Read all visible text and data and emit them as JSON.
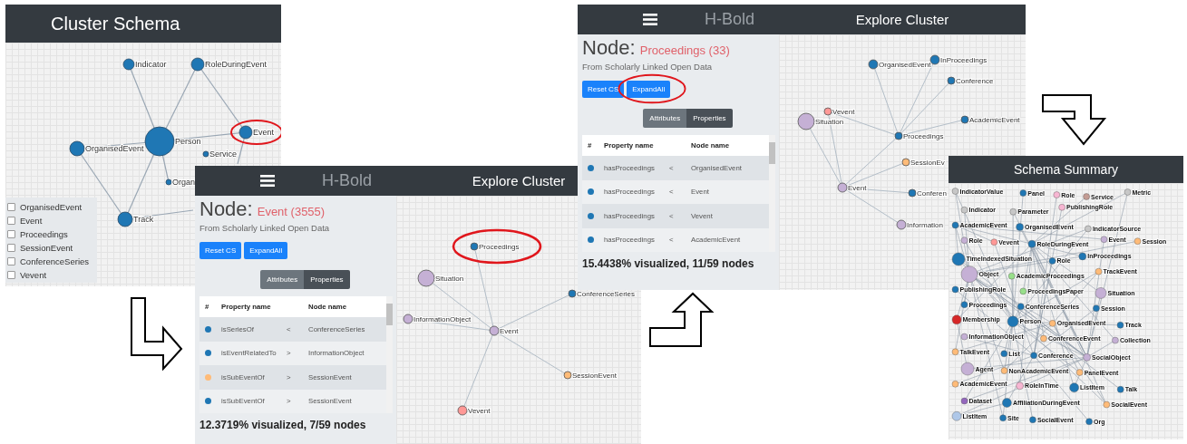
{
  "cluster_schema": {
    "title": "Cluster Schema",
    "nodes": [
      {
        "label": "Indicator",
        "color": "#1f77b4",
        "circled": false
      },
      {
        "label": "RoleDuringEvent",
        "color": "#1f77b4",
        "circled": false
      },
      {
        "label": "Person",
        "color": "#1f77b4",
        "circled": false
      },
      {
        "label": "OrganisedEvent",
        "color": "#1f77b4",
        "circled": false
      },
      {
        "label": "Event",
        "color": "#1f77b4",
        "circled": true
      },
      {
        "label": "Service",
        "color": "#1f77b4",
        "circled": false
      },
      {
        "label": "Organi",
        "color": "#1f77b4",
        "circled": false
      },
      {
        "label": "Track",
        "color": "#1f77b4",
        "circled": false
      }
    ],
    "legend": [
      {
        "label": "OrganisedEvent",
        "checked": false
      },
      {
        "label": "Event",
        "checked": false
      },
      {
        "label": "Proceedings",
        "checked": false
      },
      {
        "label": "SessionEvent",
        "checked": false
      },
      {
        "label": "ConferenceSeries",
        "checked": false
      },
      {
        "label": "Vevent",
        "checked": false
      }
    ]
  },
  "explore_panels": [
    {
      "brand": "H-Bold",
      "title": "Explore Cluster",
      "node_heading": "Node:",
      "node_name": "Event (3555)",
      "source": "From Scholarly Linked Open Data",
      "buttons": [
        {
          "label": "Reset CS",
          "circled": false
        },
        {
          "label": "ExpandAll",
          "circled": false
        }
      ],
      "toggle": [
        {
          "label": "Attributes",
          "selected": false
        },
        {
          "label": "Properties",
          "selected": true
        }
      ],
      "table": {
        "columns": [
          "#",
          "Property name",
          "Node name"
        ],
        "rows": [
          {
            "color": "#1f77b4",
            "property": "isSeriesOf",
            "direction": "<",
            "node": "ConferenceSeries"
          },
          {
            "color": "#1f77b4",
            "property": "isEventRelatedTo",
            "direction": ">",
            "node": "InformationObject"
          },
          {
            "color": "#ffbb78",
            "property": "isSubEventOf",
            "direction": ">",
            "node": "SessionEvent"
          },
          {
            "color": "#1f77b4",
            "property": "isSubEventOf",
            "direction": ">",
            "node": "SessionEvent"
          }
        ]
      },
      "status": "12.3719% visualized, 7/59 nodes",
      "graph": [
        {
          "label": "Proceedings",
          "color": "#1f77b4",
          "circled": true
        },
        {
          "label": "Situation",
          "color": "#c5b0d5",
          "circled": false
        },
        {
          "label": "ConferenceSeries",
          "color": "#1f77b4",
          "circled": false
        },
        {
          "label": "InformationObject",
          "color": "#c5b0d5",
          "circled": false
        },
        {
          "label": "Event",
          "color": "#c5b0d5",
          "circled": false
        },
        {
          "label": "SessionEvent",
          "color": "#ffbb78",
          "circled": false
        },
        {
          "label": "Vevent",
          "color": "#ff9896",
          "circled": false
        }
      ]
    },
    {
      "brand": "H-Bold",
      "title": "Explore Cluster",
      "node_heading": "Node:",
      "node_name": "Proceedings (33)",
      "source": "From Scholarly Linked Open Data",
      "buttons": [
        {
          "label": "Reset CS",
          "circled": false
        },
        {
          "label": "ExpandAll",
          "circled": true
        }
      ],
      "toggle": [
        {
          "label": "Attributes",
          "selected": false
        },
        {
          "label": "Properties",
          "selected": true
        }
      ],
      "table": {
        "columns": [
          "#",
          "Property name",
          "Node name"
        ],
        "rows": [
          {
            "color": "#1f77b4",
            "property": "hasProceedings",
            "direction": "<",
            "node": "OrganisedEvent"
          },
          {
            "color": "#1f77b4",
            "property": "hasProceedings",
            "direction": "<",
            "node": "Event"
          },
          {
            "color": "#1f77b4",
            "property": "hasProceedings",
            "direction": "<",
            "node": "Vevent"
          },
          {
            "color": "#1f77b4",
            "property": "hasProceedings",
            "direction": "<",
            "node": "AcademicEvent"
          }
        ]
      },
      "status": "15.4438% visualized, 11/59 nodes",
      "graph": [
        {
          "label": "OrganisedEvent",
          "color": "#1f77b4",
          "circled": false
        },
        {
          "label": "InProceedings",
          "color": "#1f77b4",
          "circled": false
        },
        {
          "label": "Conference",
          "color": "#1f77b4",
          "circled": false
        },
        {
          "label": "Vevent",
          "color": "#ff9896",
          "circled": false
        },
        {
          "label": "Situation",
          "color": "#c5b0d5",
          "circled": false
        },
        {
          "label": "AcademicEvent",
          "color": "#1f77b4",
          "circled": false
        },
        {
          "label": "Proceedings",
          "color": "#1f77b4",
          "circled": false
        },
        {
          "label": "SessionEv",
          "color": "#ffbb78",
          "circled": false
        },
        {
          "label": "Event",
          "color": "#c5b0d5",
          "circled": false
        },
        {
          "label": "Conferen",
          "color": "#1f77b4",
          "circled": false
        },
        {
          "label": "Information",
          "color": "#c5b0d5",
          "circled": false
        }
      ]
    }
  ],
  "schema_summary": {
    "title": "Schema Summary",
    "nodes": [
      {
        "label": "IndicatorValue",
        "color": "#c7c7c7"
      },
      {
        "label": "Panel",
        "color": "#1f77b4"
      },
      {
        "label": "Role",
        "color": "#f7b6d2"
      },
      {
        "label": "Service",
        "color": "#c49c94"
      },
      {
        "label": "Metric",
        "color": "#c7c7c7"
      },
      {
        "label": "Indicator",
        "color": "#c7c7c7"
      },
      {
        "label": "Parameter",
        "color": "#c7c7c7"
      },
      {
        "label": "PublishingRole",
        "color": "#f7b6d2"
      },
      {
        "label": "AcademicEvent",
        "color": "#1f77b4"
      },
      {
        "label": "OrganisedEvent",
        "color": "#1f77b4"
      },
      {
        "label": "IndicatorSource",
        "color": "#c7c7c7"
      },
      {
        "label": "Role",
        "color": "#c5b0d5"
      },
      {
        "label": "Vevent",
        "color": "#ff9896"
      },
      {
        "label": "RoleDuringEvent",
        "color": "#1f77b4"
      },
      {
        "label": "Event",
        "color": "#c5b0d5"
      },
      {
        "label": "Session",
        "color": "#ffbb78"
      },
      {
        "label": "TimeIndexedSituation",
        "color": "#1f77b4"
      },
      {
        "label": "Role",
        "color": "#1f77b4"
      },
      {
        "label": "InProceedings",
        "color": "#1f77b4"
      },
      {
        "label": "Object",
        "color": "#c5b0d5"
      },
      {
        "label": "AcademicProceedings",
        "color": "#98df8a"
      },
      {
        "label": "TrackEvent",
        "color": "#ffbb78"
      },
      {
        "label": "PublishingRole",
        "color": "#1f77b4"
      },
      {
        "label": "ProceedingsPaper",
        "color": "#98df8a"
      },
      {
        "label": "Situation",
        "color": "#c5b0d5"
      },
      {
        "label": "Proceedings",
        "color": "#1f77b4"
      },
      {
        "label": "ConferenceSeries",
        "color": "#1f77b4"
      },
      {
        "label": "Session",
        "color": "#1f77b4"
      },
      {
        "label": "Membership",
        "color": "#d62728"
      },
      {
        "label": "Person",
        "color": "#1f77b4"
      },
      {
        "label": "OrganisedEvent",
        "color": "#ffbb78"
      },
      {
        "label": "Track",
        "color": "#1f77b4"
      },
      {
        "label": "InformationObject",
        "color": "#c5b0d5"
      },
      {
        "label": "ConferenceEvent",
        "color": "#ffbb78"
      },
      {
        "label": "Collection",
        "color": "#c5b0d5"
      },
      {
        "label": "TalkEvent",
        "color": "#ffbb78"
      },
      {
        "label": "List",
        "color": "#1f77b4"
      },
      {
        "label": "Conference",
        "color": "#1f77b4"
      },
      {
        "label": "SocialObject",
        "color": "#c5b0d5"
      },
      {
        "label": "Agent",
        "color": "#c5b0d5"
      },
      {
        "label": "NonAcademicEvent",
        "color": "#ffbb78"
      },
      {
        "label": "PanelEvent",
        "color": "#ffbb78"
      },
      {
        "label": "AcademicEvent",
        "color": "#ffbb78"
      },
      {
        "label": "RoleInTime",
        "color": "#f7b6d2"
      },
      {
        "label": "ListItem",
        "color": "#1f77b4"
      },
      {
        "label": "Talk",
        "color": "#1f77b4"
      },
      {
        "label": "Dataset",
        "color": "#9467bd"
      },
      {
        "label": "AffiliationDuringEvent",
        "color": "#1f77b4"
      },
      {
        "label": "SocialEvent",
        "color": "#ffbb78"
      },
      {
        "label": "ListItem",
        "color": "#aec7e8"
      },
      {
        "label": "Site",
        "color": "#1f77b4"
      },
      {
        "label": "SocialEvent",
        "color": "#1f77b4"
      },
      {
        "label": "Org",
        "color": "#1f77b4"
      }
    ]
  }
}
